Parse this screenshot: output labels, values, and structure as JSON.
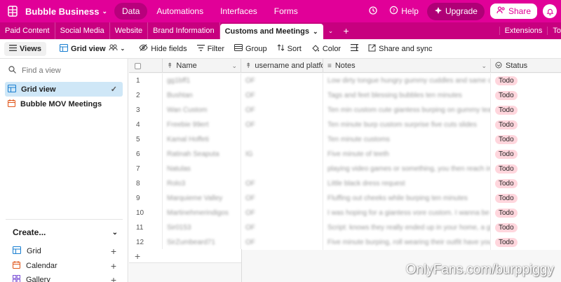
{
  "colors": {
    "brand": "#e10098",
    "tab_bar": "#c7007f",
    "selected_view": "#cfe7f7",
    "badge": "#ffd6dd"
  },
  "topbar": {
    "base_name": "Bubble Business",
    "nav": [
      "Data",
      "Automations",
      "Interfaces",
      "Forms"
    ],
    "help": "Help",
    "upgrade": "Upgrade",
    "share": "Share"
  },
  "tabs": {
    "items": [
      "Paid Content",
      "Social Media",
      "Website",
      "Brand Information"
    ],
    "active": "Customs and Meetings",
    "extensions": "Extensions",
    "truncated": "To"
  },
  "toolbar": {
    "views": "Views",
    "grid_view": "Grid view",
    "hide_fields": "Hide fields",
    "filter": "Filter",
    "group": "Group",
    "sort": "Sort",
    "color": "Color",
    "share_sync": "Share and sync"
  },
  "sidebar": {
    "find_placeholder": "Find a view",
    "views": [
      {
        "label": "Grid view",
        "icon": "grid-icon"
      },
      {
        "label": "Bubble MOV Meetings",
        "icon": "calendar-icon"
      }
    ],
    "create_label": "Create...",
    "create_items": [
      {
        "label": "Grid",
        "icon": "grid-icon"
      },
      {
        "label": "Calendar",
        "icon": "calendar-icon"
      },
      {
        "label": "Gallery",
        "icon": "gallery-icon"
      }
    ]
  },
  "grid": {
    "columns": [
      "Name",
      "username and platfo...",
      "Notes",
      "Status"
    ],
    "rows": [
      {
        "num": "1",
        "name": "gg1bff1",
        "user": "OF",
        "notes": "Low dirty tongue hungry gummy cuddles and same cuddle...",
        "status": "Todo"
      },
      {
        "num": "2",
        "name": "Bushtan",
        "user": "OF",
        "notes": "Tags and feet blessing bubbles ten minutes",
        "status": "Todo"
      },
      {
        "num": "3",
        "name": "Wan Custom",
        "user": "OF",
        "notes": "Ten min custom cute giantess burping on gummy teasing a...",
        "status": "Todo"
      },
      {
        "num": "4",
        "name": "Freebie 99ert",
        "user": "OF",
        "notes": "Ten minute burp custom surprise five cuts slides",
        "status": "Todo"
      },
      {
        "num": "5",
        "name": "Kamal Hoffeti",
        "user": "",
        "notes": "Ten minute customs",
        "status": "Todo"
      },
      {
        "num": "6",
        "name": "Ratinah Seaputa",
        "user": "IG",
        "notes": "Five minute of teeth",
        "status": "Todo"
      },
      {
        "num": "7",
        "name": "Natulas",
        "user": "",
        "notes": "playing video games or something, you then reach into your...",
        "status": "Todo"
      },
      {
        "num": "8",
        "name": "Rolo3",
        "user": "OF",
        "notes": "Little black dress request",
        "status": "Todo"
      },
      {
        "num": "9",
        "name": "Marquieme Valley",
        "user": "OF",
        "notes": "Fluffing out cheeks while burping ten minutes",
        "status": "Todo"
      },
      {
        "num": "10",
        "name": "Martinehmerindigos",
        "user": "OF",
        "notes": "I was hoping for a giantess vore custom. I wanna be eaten b...",
        "status": "Todo"
      },
      {
        "num": "11",
        "name": "Sir0153",
        "user": "OF",
        "notes": "Script: knows they really ended up in your home, a gigantic s...",
        "status": "Todo"
      },
      {
        "num": "12",
        "name": "SirZumbeard71",
        "user": "OF",
        "notes": "Five minute burping, roll wearing their outfit have your head...",
        "status": "Todo"
      }
    ]
  },
  "watermark": "OnlyFans.com/burppiggy"
}
